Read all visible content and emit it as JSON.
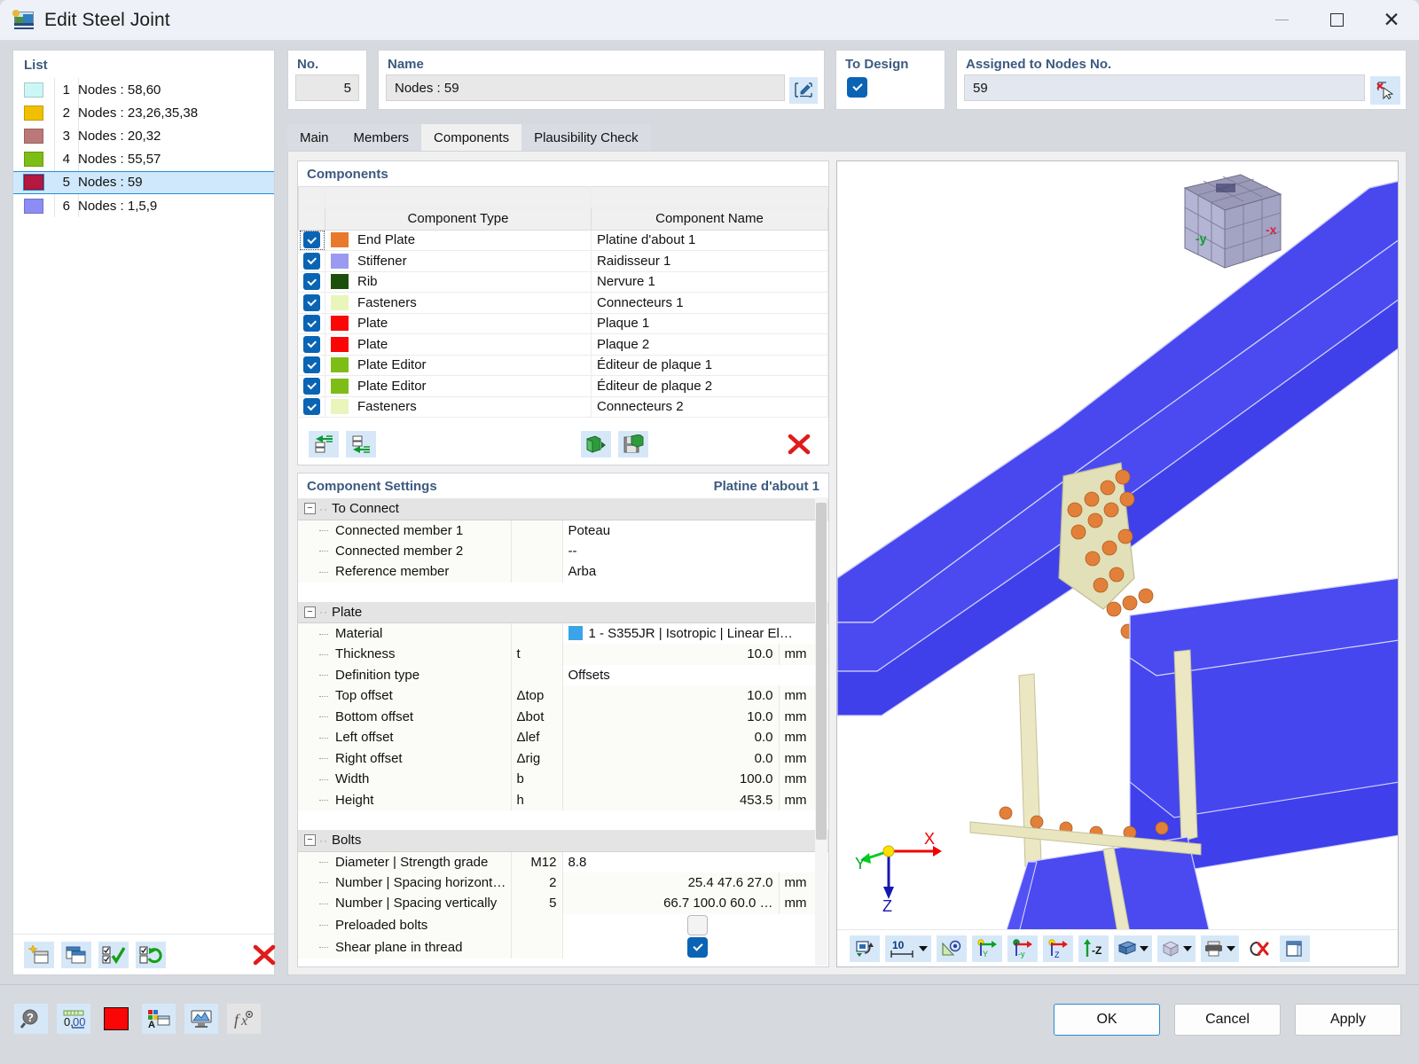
{
  "window": {
    "title": "Edit Steel Joint",
    "icon": "steel-joint-icon",
    "minimize": "—",
    "maximize": "□",
    "close": "✕"
  },
  "list_panel": {
    "title": "List",
    "items": [
      {
        "index": "1",
        "label": "Nodes : 58,60",
        "color": "#ccf7f7"
      },
      {
        "index": "2",
        "label": "Nodes : 23,26,35,38",
        "color": "#f0c000"
      },
      {
        "index": "3",
        "label": "Nodes : 20,32",
        "color": "#bb7878"
      },
      {
        "index": "4",
        "label": "Nodes : 55,57",
        "color": "#7dbd16"
      },
      {
        "index": "5",
        "label": "Nodes : 59",
        "color": "#b5173f"
      },
      {
        "index": "6",
        "label": "Nodes : 1,5,9",
        "color": "#8c8cf5"
      }
    ],
    "selected_index": 4,
    "footer_buttons": [
      {
        "name": "new-joint-button",
        "icon": "new-window-icon"
      },
      {
        "name": "copy-joint-button",
        "icon": "copy-window-icon"
      },
      {
        "name": "check-all-button",
        "icon": "check-all-icon"
      },
      {
        "name": "invert-selection-button",
        "icon": "invert-check-icon"
      },
      {
        "name": "delete-joint-button",
        "icon": "red-x-icon"
      }
    ]
  },
  "header": {
    "no_label": "No.",
    "no_value": "5",
    "name_label": "Name",
    "name_value": "Nodes : 59",
    "name_edit_icon": "pencil-edit-icon",
    "to_design_label": "To Design",
    "to_design_checked": true,
    "assigned_label": "Assigned to Nodes No.",
    "assigned_value": "59",
    "assigned_pick_icon": "pick-node-icon"
  },
  "tabs": [
    {
      "label": "Main",
      "active": false
    },
    {
      "label": "Members",
      "active": false
    },
    {
      "label": "Components",
      "active": true
    },
    {
      "label": "Plausibility Check",
      "active": false
    }
  ],
  "components_panel": {
    "title": "Components",
    "columns": [
      "",
      "Component Type",
      "Component Name"
    ],
    "rows": [
      {
        "checked": true,
        "color": "#e8792c",
        "type": "End Plate",
        "name": "Platine d'about 1",
        "focused": true
      },
      {
        "checked": true,
        "color": "#9a9af2",
        "type": "Stiffener",
        "name": "Raidisseur 1",
        "focused": false
      },
      {
        "checked": true,
        "color": "#1d4f0c",
        "type": "Rib",
        "name": "Nervure 1",
        "focused": false
      },
      {
        "checked": true,
        "color": "#e9f5bb",
        "type": "Fasteners",
        "name": "Connecteurs 1",
        "focused": false
      },
      {
        "checked": true,
        "color": "#fb0606",
        "type": "Plate",
        "name": "Plaque 1",
        "focused": false
      },
      {
        "checked": true,
        "color": "#fb0606",
        "type": "Plate",
        "name": "Plaque 2",
        "focused": false
      },
      {
        "checked": true,
        "color": "#7dbd16",
        "type": "Plate Editor",
        "name": "Éditeur de plaque 1",
        "focused": false
      },
      {
        "checked": true,
        "color": "#7dbd16",
        "type": "Plate Editor",
        "name": "Éditeur de plaque 2",
        "focused": false
      },
      {
        "checked": true,
        "color": "#e9f5bb",
        "type": "Fasteners",
        "name": "Connecteurs 2",
        "focused": false
      }
    ],
    "toolbar_buttons": [
      {
        "name": "insert-component-above-button",
        "icon": "insert-above-icon"
      },
      {
        "name": "insert-component-below-button",
        "icon": "insert-below-icon"
      },
      {
        "name": "import-component-button",
        "icon": "import-component-icon"
      },
      {
        "name": "save-component-button",
        "icon": "save-component-icon"
      },
      {
        "name": "delete-component-button",
        "icon": "red-x-icon"
      }
    ]
  },
  "settings_panel": {
    "title": "Component Settings",
    "subject": "Platine d'about 1",
    "groups": [
      {
        "name": "To Connect",
        "expanded": true,
        "rows": [
          {
            "label": "Connected member 1",
            "symbol": "",
            "value": "Poteau",
            "unit": "",
            "align": "left"
          },
          {
            "label": "Connected member 2",
            "symbol": "",
            "value": "--",
            "unit": "",
            "align": "left"
          },
          {
            "label": "Reference member",
            "symbol": "",
            "value": "Arba",
            "unit": "",
            "align": "left"
          }
        ]
      },
      {
        "name": "Plate",
        "expanded": true,
        "rows": [
          {
            "label": "Material",
            "symbol": "",
            "value": "1 - S355JR | Isotropic | Linear El…",
            "unit": "",
            "align": "left",
            "swatch": "#3ba3e8"
          },
          {
            "label": "Thickness",
            "symbol": "t",
            "value": "10.0",
            "unit": "mm",
            "align": "right"
          },
          {
            "label": "Definition type",
            "symbol": "",
            "value": "Offsets",
            "unit": "",
            "align": "left"
          },
          {
            "label": "Top offset",
            "symbol": "Δtop",
            "value": "10.0",
            "unit": "mm",
            "align": "right"
          },
          {
            "label": "Bottom offset",
            "symbol": "Δbot",
            "value": "10.0",
            "unit": "mm",
            "align": "right"
          },
          {
            "label": "Left offset",
            "symbol": "Δlef",
            "value": "0.0",
            "unit": "mm",
            "align": "right"
          },
          {
            "label": "Right offset",
            "symbol": "Δrig",
            "value": "0.0",
            "unit": "mm",
            "align": "right"
          },
          {
            "label": "Width",
            "symbol": "b",
            "value": "100.0",
            "unit": "mm",
            "align": "right"
          },
          {
            "label": "Height",
            "symbol": "h",
            "value": "453.5",
            "unit": "mm",
            "align": "right"
          }
        ]
      },
      {
        "name": "Bolts",
        "expanded": true,
        "rows": [
          {
            "label": "Diameter | Strength grade",
            "symbol": "M12",
            "value": "8.8",
            "unit": "",
            "align": "left"
          },
          {
            "label": "Number | Spacing horizont…",
            "symbol": "2",
            "value": "25.4 47.6 27.0",
            "unit": "mm",
            "align": "right"
          },
          {
            "label": "Number | Spacing vertically",
            "symbol": "5",
            "value": "66.7 100.0 60.0 …",
            "unit": "mm",
            "align": "right"
          },
          {
            "label": "Preloaded bolts",
            "symbol": "",
            "value": "",
            "unit": "",
            "align": "center",
            "checkbox": false
          },
          {
            "label": "Shear plane in thread",
            "symbol": "",
            "value": "",
            "unit": "",
            "align": "center",
            "checkbox": true
          }
        ]
      }
    ]
  },
  "viewport": {
    "nav_cube": {
      "face_left": "-y",
      "face_right": "-x"
    },
    "axes": {
      "x": "X",
      "y": "Y",
      "z": "Z"
    },
    "zoom_value": "10",
    "toolbar_buttons": [
      {
        "name": "render-mode-button",
        "icon": "render-toggle-icon"
      },
      {
        "name": "zoom-factor-dropdown",
        "icon": "measure-icon"
      },
      {
        "name": "visibility-button",
        "icon": "eye-triangle-icon"
      },
      {
        "name": "view-in-y-button",
        "icon": "axis-y-icon"
      },
      {
        "name": "view-in-negative-y-button",
        "icon": "axis-neg-y-icon"
      },
      {
        "name": "view-in-z-button",
        "icon": "axis-z-icon"
      },
      {
        "name": "view-in-negative-z-button",
        "icon": "axis-neg-z-icon"
      },
      {
        "name": "display-style-dropdown",
        "icon": "solid-model-icon"
      },
      {
        "name": "wireframe-dropdown",
        "icon": "wireframe-cube-icon"
      },
      {
        "name": "print-dropdown",
        "icon": "printer-icon"
      },
      {
        "name": "clear-selection-button",
        "icon": "clear-selection-icon"
      },
      {
        "name": "panel-toggle-button",
        "icon": "panel-toggle-icon"
      }
    ]
  },
  "bottom_bar": {
    "tool_buttons": [
      {
        "name": "help-button",
        "icon": "help-magnifier-icon"
      },
      {
        "name": "decimal-places-button",
        "icon": "decimals-icon"
      },
      {
        "name": "color-button",
        "icon": "red-color-swatch-icon"
      },
      {
        "name": "display-properties-button",
        "icon": "display-properties-icon"
      },
      {
        "name": "graphic-settings-button",
        "icon": "graphic-settings-icon"
      },
      {
        "name": "formula-button",
        "icon": "fx-icon"
      }
    ],
    "buttons": [
      {
        "label": "OK",
        "primary": true
      },
      {
        "label": "Cancel",
        "primary": false
      },
      {
        "label": "Apply",
        "primary": false
      }
    ]
  }
}
